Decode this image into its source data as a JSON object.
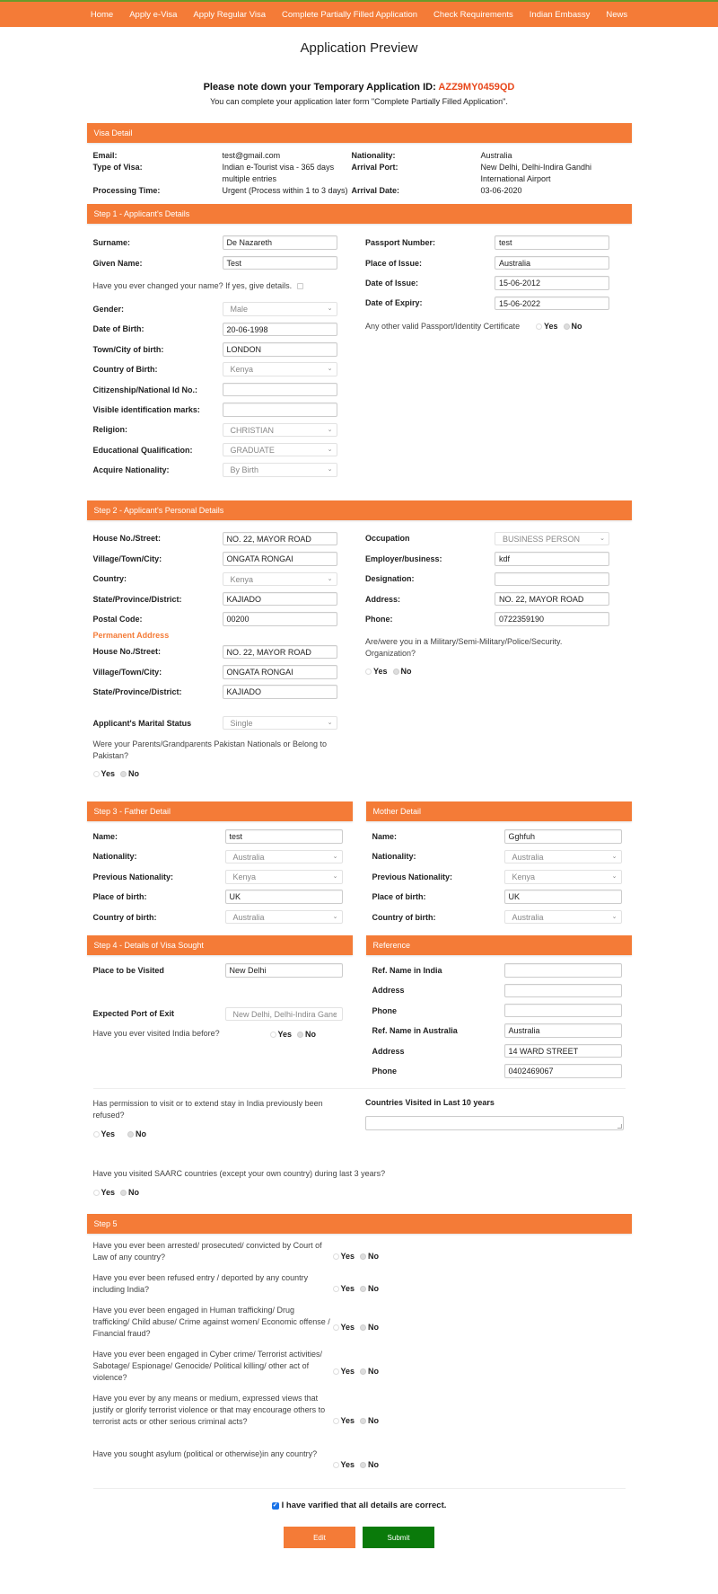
{
  "nav": {
    "items": [
      "Home",
      "Apply e-Visa",
      "Apply Regular Visa",
      "Complete Partially Filled Application",
      "Check Requirements",
      "Indian Embassy",
      "News"
    ]
  },
  "page": {
    "title": "Application Preview",
    "notice_prefix": "Please note down your Temporary Application ID: ",
    "application_id": "AZZ9MY0459QD",
    "notice_sub": "You can complete your application later form \"Complete Partially Filled Application\"."
  },
  "colors": {
    "accent": "#f47b37",
    "id_red": "#e8481c",
    "submit_green": "#0a7a0a"
  },
  "visa_detail": {
    "heading": "Visa Detail",
    "rows": [
      {
        "l1": "Email:",
        "v1": "test@gmail.com",
        "l2": "Nationality:",
        "v2": "Australia"
      },
      {
        "l1": "Type of Visa:",
        "v1": "Indian e-Tourist visa - 365 days multiple entries",
        "l2": "Arrival Port:",
        "v2": "New Delhi, Delhi-Indira Gandhi International Airport"
      },
      {
        "l1": "Processing Time:",
        "v1": "Urgent (Process within 1 to 3 days)",
        "l2": "Arrival Date:",
        "v2": "03-06-2020"
      }
    ]
  },
  "step1": {
    "heading": "Step 1 - Applicant's Details",
    "surname": {
      "label": "Surname:",
      "value": "De Nazareth"
    },
    "given_name": {
      "label": "Given Name:",
      "value": "Test"
    },
    "changed_name_q": "Have you ever changed your name? If yes, give details.",
    "gender": {
      "label": "Gender:",
      "value": "Male"
    },
    "dob": {
      "label": "Date of Birth:",
      "value": "20-06-1998"
    },
    "town_birth": {
      "label": "Town/City of birth:",
      "value": "LONDON"
    },
    "country_birth": {
      "label": "Country of Birth:",
      "value": "Kenya"
    },
    "national_id": {
      "label": "Citizenship/National Id No.:",
      "value": ""
    },
    "marks": {
      "label": "Visible identification marks:",
      "value": ""
    },
    "religion": {
      "label": "Religion:",
      "value": "CHRISTIAN"
    },
    "education": {
      "label": "Educational Qualification:",
      "value": "GRADUATE"
    },
    "acquire_nat": {
      "label": "Acquire Nationality:",
      "value": "By Birth"
    },
    "passport_no": {
      "label": "Passport Number:",
      "value": "test"
    },
    "place_issue": {
      "label": "Place of Issue:",
      "value": "Australia"
    },
    "date_issue": {
      "label": "Date of Issue:",
      "value": "15-06-2012"
    },
    "date_expiry": {
      "label": "Date of Expiry:",
      "value": "15-06-2022"
    },
    "other_passport_q": "Any other valid Passport/Identity Certificate",
    "other_passport_answer": "No"
  },
  "radio": {
    "yes": "Yes",
    "no": "No"
  },
  "step2": {
    "heading": "Step 2 - Applicant's Personal Details",
    "house": {
      "label": "House No./Street:",
      "value": "NO. 22, MAYOR ROAD"
    },
    "village": {
      "label": "Village/Town/City:",
      "value": "ONGATA RONGAI"
    },
    "country": {
      "label": "Country:",
      "value": "Kenya"
    },
    "state": {
      "label": "State/Province/District:",
      "value": "KAJIADO"
    },
    "postal": {
      "label": "Postal Code:",
      "value": "00200"
    },
    "permanent_heading": "Permanent Address",
    "p_house": {
      "label": "House No./Street:",
      "value": "NO. 22, MAYOR ROAD"
    },
    "p_village": {
      "label": "Village/Town/City:",
      "value": "ONGATA RONGAI"
    },
    "p_state": {
      "label": "State/Province/District:",
      "value": "KAJIADO"
    },
    "marital": {
      "label": "Applicant's Marital Status",
      "value": "Single"
    },
    "pakistan_q": "Were your Parents/Grandparents Pakistan Nationals or Belong to Pakistan?",
    "pakistan_answer": "No",
    "occupation": {
      "label": "Occupation",
      "value": "BUSINESS PERSON"
    },
    "employer": {
      "label": "Employer/business:",
      "value": "kdf"
    },
    "designation": {
      "label": "Designation:",
      "value": ""
    },
    "address": {
      "label": "Address:",
      "value": "NO. 22, MAYOR ROAD"
    },
    "phone": {
      "label": "Phone:",
      "value": "0722359190"
    },
    "military_q": "Are/were you in a Military/Semi-Military/Police/Security. Organization?",
    "military_answer": "No"
  },
  "step3": {
    "father_heading": "Step 3 - Father Detail",
    "mother_heading": "Mother Detail",
    "father": {
      "name": {
        "label": "Name:",
        "value": "test"
      },
      "nationality": {
        "label": "Nationality:",
        "value": "Australia"
      },
      "prev_nat": {
        "label": "Previous Nationality:",
        "value": "Kenya"
      },
      "place_birth": {
        "label": "Place of birth:",
        "value": "UK"
      },
      "country_birth": {
        "label": "Country of birth:",
        "value": "Australia"
      }
    },
    "mother": {
      "name": {
        "label": "Name:",
        "value": "Gghfuh"
      },
      "nationality": {
        "label": "Nationality:",
        "value": "Australia"
      },
      "prev_nat": {
        "label": "Previous Nationality:",
        "value": "Kenya"
      },
      "place_birth": {
        "label": "Place of birth:",
        "value": "UK"
      },
      "country_birth": {
        "label": "Country of birth:",
        "value": "Australia"
      }
    }
  },
  "step4": {
    "heading": "Step 4 - Details of Visa Sought",
    "place": {
      "label": "Place to be Visited",
      "value": "New Delhi"
    },
    "exit_port": {
      "label": "Expected Port of Exit",
      "value": "New Delhi, Delhi-Indira Ganc"
    },
    "visited_q": "Have you ever visited India before?",
    "visited_answer": "No",
    "refused_q": "Has permission to visit or to extend stay in India previously been refused?",
    "refused_answer": "No",
    "countries_label": "Countries Visited in Last 10 years",
    "countries_value": "",
    "saarc_q": "Have you visited SAARC countries (except your own country) during last 3 years?",
    "saarc_answer": "No"
  },
  "reference": {
    "heading": "Reference",
    "india_name": {
      "label": "Ref. Name in India",
      "value": ""
    },
    "india_address": {
      "label": "Address",
      "value": ""
    },
    "india_phone": {
      "label": "Phone",
      "value": ""
    },
    "aus_name": {
      "label": "Ref. Name in Australia",
      "value": "Australia"
    },
    "aus_address": {
      "label": "Address",
      "value": "14 WARD STREET"
    },
    "aus_phone": {
      "label": "Phone",
      "value": "0402469067"
    }
  },
  "step5": {
    "heading": "Step 5",
    "questions": [
      {
        "q": "Have you ever been arrested/ prosecuted/ convicted by Court of Law of any country?",
        "answer": "No"
      },
      {
        "q": "Have you ever been refused entry / deported by any country including India?",
        "answer": "No"
      },
      {
        "q": "Have you ever been engaged in Human trafficking/ Drug trafficking/ Child abuse/ Crime against women/ Economic offense / Financial fraud?",
        "answer": "No"
      },
      {
        "q": "Have you ever been engaged in Cyber crime/ Terrorist activities/ Sabotage/ Espionage/ Genocide/ Political killing/ other act of violence?",
        "answer": "No"
      },
      {
        "q": "Have you ever by any means or medium, expressed views that justify or glorify terrorist violence or that may encourage others to terrorist acts or other serious criminal acts?",
        "answer": "No"
      },
      {
        "q": "Have you sought asylum (political or otherwise)in any country?",
        "answer": "No"
      }
    ]
  },
  "footer": {
    "verify_label": "I have varified that all details are correct.",
    "verify_checked": true,
    "edit_label": "Edit",
    "submit_label": "Submit"
  }
}
